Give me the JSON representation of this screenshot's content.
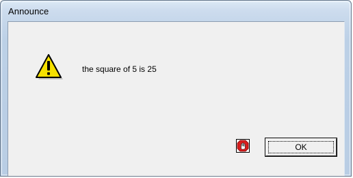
{
  "window": {
    "title": "Announce"
  },
  "dialog": {
    "icon": "warning-icon",
    "message": "the square of 5 is 25",
    "stop_icon": "stop-hand-icon",
    "ok_label": "OK"
  },
  "colors": {
    "title_bar": "#c4d6ea",
    "client_bg": "#f0f0f0",
    "warning_yellow": "#f5e000",
    "stop_red": "#d81e1e"
  }
}
